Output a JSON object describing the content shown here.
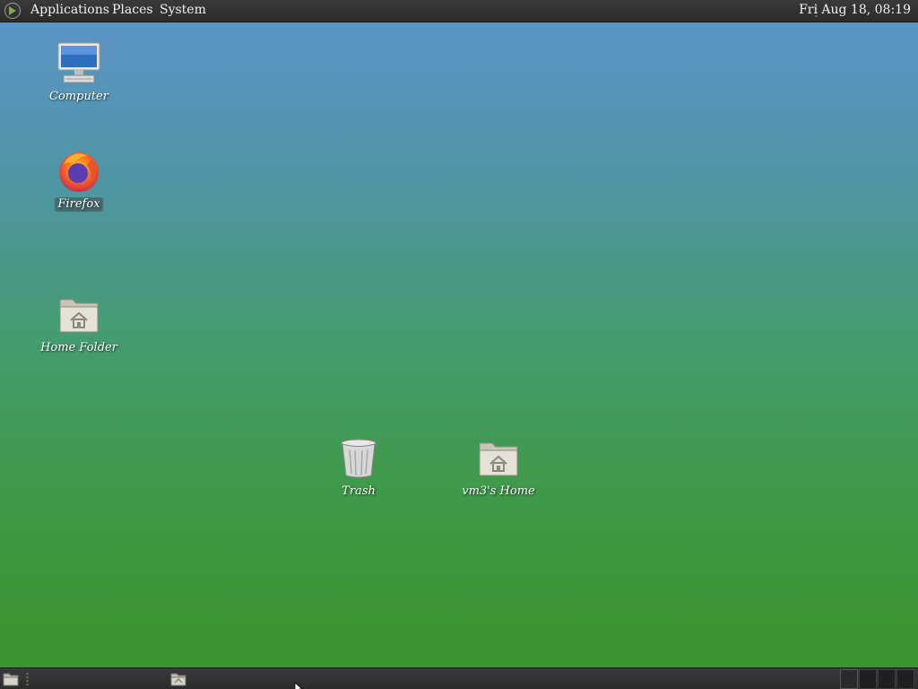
{
  "top_panel": {
    "menus": {
      "applications": "Applications",
      "places": "Places",
      "system": "System"
    },
    "clock": "Fri Aug 18, 08:19"
  },
  "desktop": {
    "icons": {
      "computer": "Computer",
      "firefox": "Firefox",
      "home_folder": "Home Folder",
      "trash": "Trash",
      "vm3_home": "vm3's Home"
    }
  },
  "bottom_panel": {
    "workspaces": 4
  },
  "colors": {
    "panel": "#2f2f2f",
    "desktop_top": "#5b94c6",
    "desktop_bottom": "#3a942e"
  }
}
